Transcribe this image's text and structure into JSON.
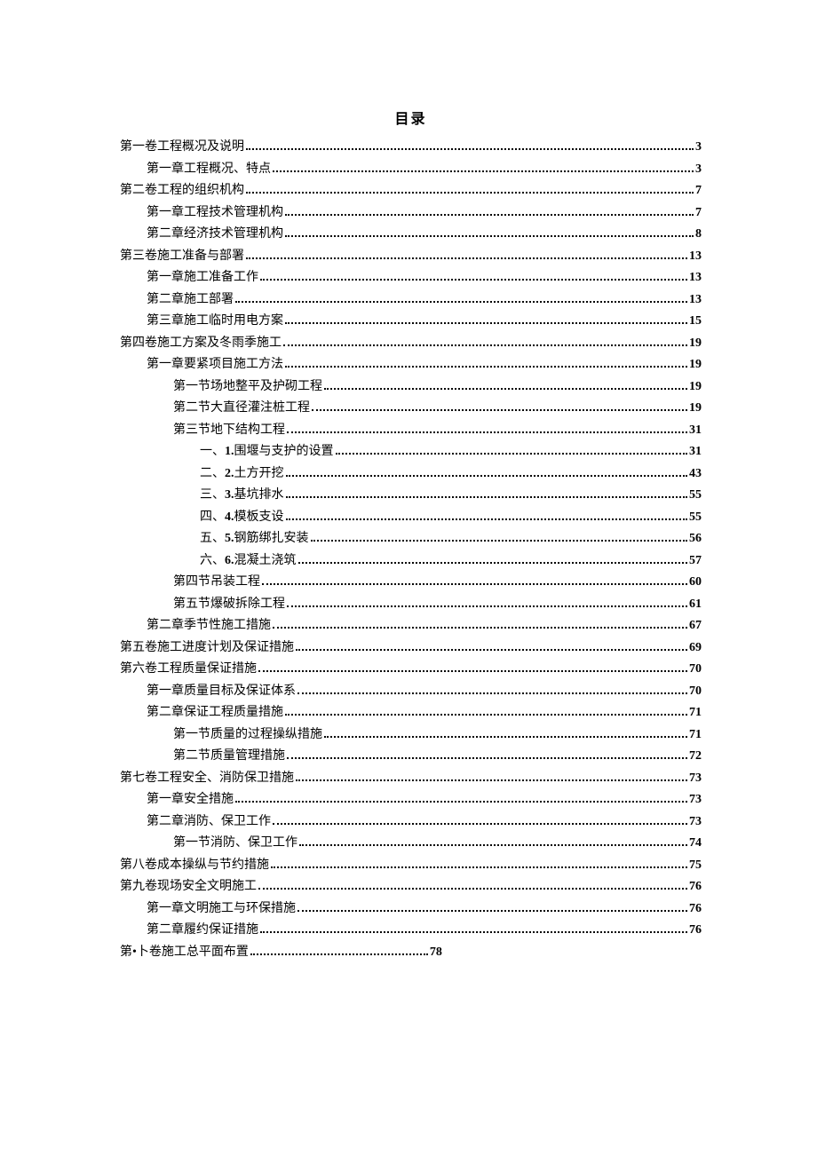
{
  "title": "目录",
  "entries": [
    {
      "level": 0,
      "label": "第一卷工程概况及说明",
      "page": "3"
    },
    {
      "level": 1,
      "label": "第一章工程概况、特点",
      "page": "3"
    },
    {
      "level": 0,
      "label": "第二卷工程的组织机构",
      "page": "7"
    },
    {
      "level": 1,
      "label": "第一章工程技术管理机构",
      "page": "7"
    },
    {
      "level": 1,
      "label": "第二章经济技术管理机构",
      "page": "8"
    },
    {
      "level": 0,
      "label": "第三卷施工准备与部署",
      "page": "13"
    },
    {
      "level": 1,
      "label": "第一章施工准备工作",
      "page": "13"
    },
    {
      "level": 1,
      "label": "第二章施工部署",
      "page": "13"
    },
    {
      "level": 1,
      "label": "第三章施工临时用电方案",
      "page": "15"
    },
    {
      "level": 0,
      "label": "第四卷施工方案及冬雨季施工",
      "page": "19"
    },
    {
      "level": 1,
      "label": "第一章要紧项目施工方法",
      "page": "19"
    },
    {
      "level": 2,
      "label": "第一节场地整平及护砌工程",
      "page": "19"
    },
    {
      "level": 2,
      "label": "第二节大直径灌注桩工程",
      "page": "19"
    },
    {
      "level": 2,
      "label": "第三节地下结构工程",
      "page": "31"
    },
    {
      "level": 3,
      "prefix": "一、",
      "num": "1.",
      "suffix": "围堰与支护的设置",
      "page": "31"
    },
    {
      "level": 3,
      "prefix": "二、",
      "num": "2.",
      "suffix": "土方开挖",
      "page": "43"
    },
    {
      "level": 3,
      "prefix": "三、",
      "num": "3.",
      "suffix": "基坑排水",
      "page": "55"
    },
    {
      "level": 3,
      "prefix": "四、",
      "num": "4.",
      "suffix": "模板支设",
      "page": "55"
    },
    {
      "level": 3,
      "prefix": "五、",
      "num": "5.",
      "suffix": "钢筋绑扎安装",
      "page": "56"
    },
    {
      "level": 3,
      "prefix": "六、",
      "num": "6.",
      "suffix": "混凝土浇筑",
      "page": "57"
    },
    {
      "level": 2,
      "label": "第四节吊装工程",
      "page": "60"
    },
    {
      "level": 2,
      "label": "第五节爆破拆除工程",
      "page": "61"
    },
    {
      "level": 1,
      "label": "第二章季节性施工措施",
      "page": "67"
    },
    {
      "level": 0,
      "label": "第五卷施工进度计划及保证措施",
      "page": "69"
    },
    {
      "level": 0,
      "label": "第六卷工程质量保证措施",
      "page": "70"
    },
    {
      "level": 1,
      "label": "第一章质量目标及保证体系",
      "page": "70"
    },
    {
      "level": 1,
      "label": "第二章保证工程质量措施",
      "page": "71"
    },
    {
      "level": 2,
      "label": "第一节质量的过程操纵措施",
      "page": "71"
    },
    {
      "level": 2,
      "label": "第二节质量管理措施",
      "page": "72"
    },
    {
      "level": 0,
      "label": "第七卷工程安全、消防保卫措施",
      "page": "73"
    },
    {
      "level": 1,
      "label": "第一章安全措施",
      "page": "73"
    },
    {
      "level": 1,
      "label": "第二章消防、保卫工作",
      "page": "73"
    },
    {
      "level": 2,
      "label": "第一节消防、保卫工作",
      "page": "74"
    },
    {
      "level": 0,
      "label": "第八卷成本操纵与节约措施",
      "page": "75"
    },
    {
      "level": 0,
      "label": "第九卷现场安全文明施工",
      "page": "76"
    },
    {
      "level": 1,
      "label": "第一章文明施工与环保措施",
      "page": "76"
    },
    {
      "level": 1,
      "label": "第二章履约保证措施",
      "page": "76"
    },
    {
      "level": 0,
      "label": "第•卜卷施工总平面布置",
      "page": "78",
      "short": true
    }
  ]
}
